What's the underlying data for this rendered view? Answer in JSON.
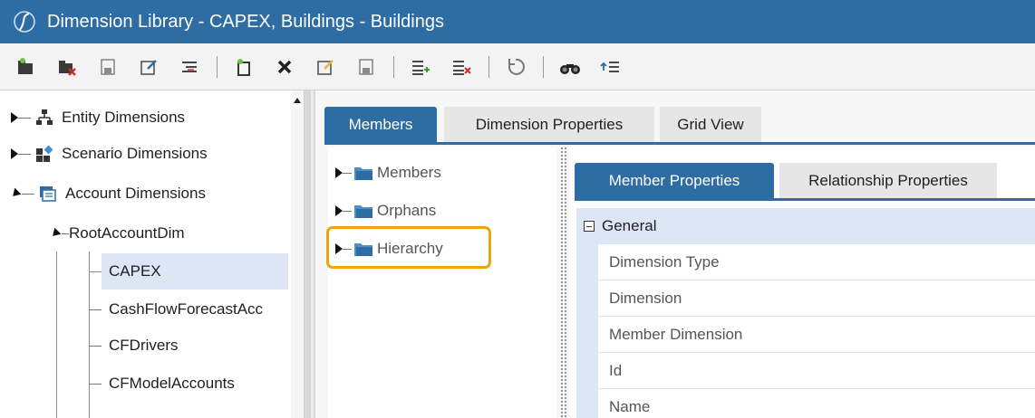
{
  "window": {
    "title": "Dimension Library - CAPEX, Buildings - Buildings"
  },
  "toolbar": {
    "buttons": [
      "create-dimension-icon",
      "delete-dimension-icon",
      "save-dimension-icon",
      "rename-dimension-icon",
      "dimension-relationships-icon",
      "create-member-icon",
      "delete-member-icon",
      "rename-member-icon",
      "save-member-icon",
      "add-relationship-icon",
      "remove-relationship-icon",
      "refresh-icon",
      "search-icon",
      "move-up-icon"
    ]
  },
  "left_tree": {
    "entity": "Entity Dimensions",
    "scenario": "Scenario Dimensions",
    "account": "Account Dimensions",
    "root": "RootAccountDim",
    "children": [
      "CAPEX",
      "CashFlowForecastAcc",
      "CFDrivers",
      "CFModelAccounts"
    ]
  },
  "tabs": {
    "members": "Members",
    "dimension_properties": "Dimension Properties",
    "grid_view": "Grid View"
  },
  "members_tree": {
    "items": [
      "Members",
      "Orphans",
      "Hierarchy"
    ]
  },
  "props_tabs": {
    "member_properties": "Member Properties",
    "relationship_properties": "Relationship Properties"
  },
  "properties": {
    "group": "General",
    "rows": [
      "Dimension Type",
      "Dimension",
      "Member Dimension",
      "Id",
      "Name"
    ]
  },
  "colors": {
    "accent": "#2e6da4",
    "highlight": "#f0a30a",
    "selection": "#dce6f4"
  }
}
